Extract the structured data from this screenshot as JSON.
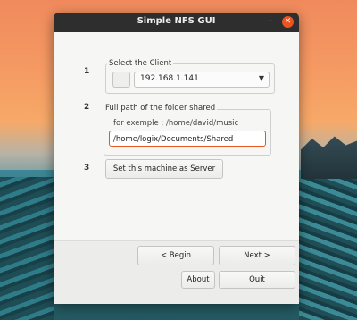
{
  "window": {
    "title": "Simple NFS GUI",
    "minimize_glyph": "–",
    "close_glyph": "✕"
  },
  "colors": {
    "accent": "#e95420",
    "titlebar": "#2e2e2e",
    "window_bg": "#f6f6f5"
  },
  "steps": {
    "step1": {
      "number": "1",
      "legend": "Select the Client",
      "browse_label": "...",
      "client_value": "192.168.1.141",
      "arrow_icon": "chevron-down-icon"
    },
    "step2": {
      "number": "2",
      "legend": "Full path of the folder shared",
      "hint": "for exemple : /home/david/music",
      "path_value": "/home/logix/Documents/Shared"
    },
    "step3": {
      "number": "3",
      "server_button": "Set this machine as Server"
    }
  },
  "footer": {
    "begin": "< Begin",
    "next": "Next >",
    "about": "About",
    "quit": "Quit"
  }
}
